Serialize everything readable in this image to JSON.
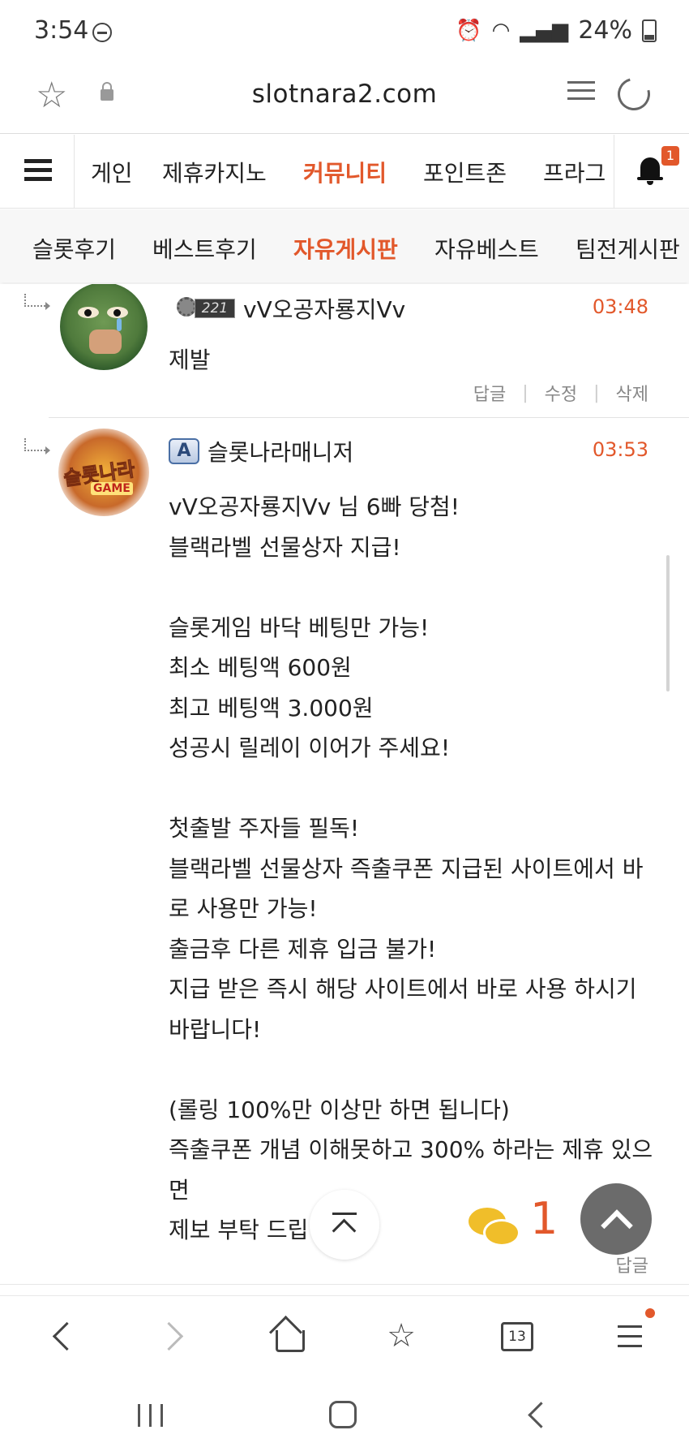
{
  "status_bar": {
    "time": "3:54",
    "battery": "24%",
    "icons": [
      "do-not-disturb-icon",
      "alarm-icon",
      "wifi-icon",
      "signal-icon",
      "battery-icon"
    ]
  },
  "address_bar": {
    "url": "slotnara2.com",
    "icons": [
      "star-icon",
      "lock-icon",
      "reader-mode-icon",
      "refresh-icon"
    ]
  },
  "main_nav": {
    "items": [
      {
        "label": "게인",
        "active": false
      },
      {
        "label": "제휴카지노",
        "active": false
      },
      {
        "label": "커뮤니티",
        "active": true
      },
      {
        "label": "포인트존",
        "active": false
      },
      {
        "label": "프라그",
        "active": false
      }
    ],
    "notification_count": "1"
  },
  "sub_nav": {
    "items": [
      {
        "label": "슬롯후기",
        "active": false
      },
      {
        "label": "베스트후기",
        "active": false
      },
      {
        "label": "자유게시판",
        "active": true
      },
      {
        "label": "자유베스트",
        "active": false
      },
      {
        "label": "팀전게시판",
        "active": false
      }
    ]
  },
  "comments": [
    {
      "author": "vV오공자룡지Vv",
      "level": "221",
      "time": "03:48",
      "text": "제발",
      "actions": [
        "답글",
        "수정",
        "삭제"
      ]
    },
    {
      "author": "슬롯나라매니저",
      "badge": "A",
      "avatar_text": "슬롯나라",
      "avatar_sub": "GAME",
      "time": "03:53",
      "body": "vV오공자룡지Vv 님 6빠 당첨!\n블랙라벨 선물상자 지급!\n\n슬롯게임 바닥 베팅만 가능!\n최소 베팅액 600원\n최고 베팅액 3.000원\n성공시 릴레이 이어가 주세요!\n\n첫출발 주자들 필독!\n블랙라벨 선물상자 즉출쿠폰 지급된 사이트에서 바\n로 사용만 가능!\n출금후 다른 제휴 입금 불가!\n지급 받은 즉시 해당 사이트에서 바로 사용 하시기\n바랍니다!\n\n(롤링 100%만 이상만 하면 됩니다)\n즉출쿠폰 개념 이해못하고 300% 하라는 제휴 있으\n면\n제보 부탁 드립",
      "reply_label": "답글"
    }
  ],
  "chat_count": "1",
  "browser_toolbar": {
    "tab_count": "13",
    "icons": [
      "back-icon",
      "forward-icon",
      "home-icon",
      "bookmarks-icon",
      "tabs-icon",
      "menu-icon"
    ]
  },
  "colors": {
    "accent": "#e2582b",
    "text": "#222222",
    "muted": "#888888",
    "float_button": "#6b6b6b",
    "chat_icon": "#f0be2a"
  }
}
